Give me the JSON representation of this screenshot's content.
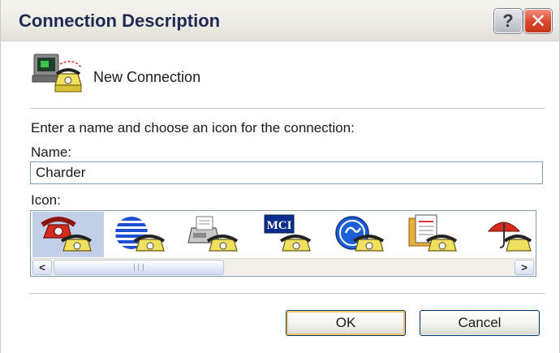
{
  "window": {
    "title": "Connection Description",
    "help_glyph": "?",
    "close_glyph": "✕"
  },
  "header": {
    "icon": "telephone-computer-icon",
    "label": "New Connection"
  },
  "form": {
    "instruction": "Enter a name and choose an icon for the connection:",
    "name_label": "Name:",
    "name_value": "Charder",
    "icon_label": "Icon:"
  },
  "icon_list": {
    "items": [
      {
        "icon": "red-telephone-icon",
        "selected": true
      },
      {
        "icon": "striped-globe-icon",
        "selected": false
      },
      {
        "icon": "fax-machine-icon",
        "selected": false
      },
      {
        "icon": "mci-logo-icon",
        "selected": false
      },
      {
        "icon": "ge-logo-icon",
        "selected": false
      },
      {
        "icon": "documents-icon",
        "selected": false
      },
      {
        "icon": "umbrella-icon",
        "selected": false
      }
    ],
    "scroll_left": "<",
    "scroll_right": ">",
    "mci_text": "MCI"
  },
  "buttons": {
    "ok": "OK",
    "cancel": "Cancel"
  },
  "colors": {
    "title_text": "#1f2a52",
    "selection": "#c2cfe6",
    "close_red": "#d8452c",
    "ok_focus": "#f3c36a"
  }
}
